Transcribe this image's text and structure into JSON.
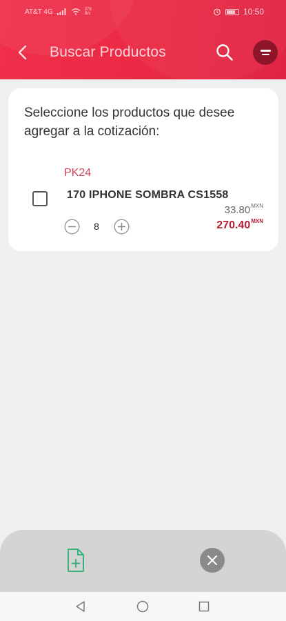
{
  "status_bar": {
    "carrier": "AT&T 4G",
    "speed_value": "378",
    "speed_unit": "B/s",
    "time": "10:50"
  },
  "header": {
    "title": "Buscar Productos",
    "icons": [
      "back-arrow-icon",
      "search-icon",
      "filter-icon"
    ]
  },
  "card": {
    "instruction": "Seleccione los productos que desee agregar a la cotización:",
    "product": {
      "code": "PK24",
      "name": "170 IPHONE SOMBRA CS1558",
      "quantity": "8",
      "unit_price": "33.80",
      "total_price": "270.40",
      "currency": "MXN",
      "selected": false
    }
  },
  "bottom_actions": {
    "icons": [
      "add-document-icon",
      "close-icon"
    ]
  },
  "colors": {
    "header_red": "#ea2a44",
    "filter_button": "#8e1428",
    "code_text": "#d2405a",
    "total_price": "#b31e35",
    "add_doc_green": "#3bb27b",
    "close_grey": "#8a8a8a"
  }
}
